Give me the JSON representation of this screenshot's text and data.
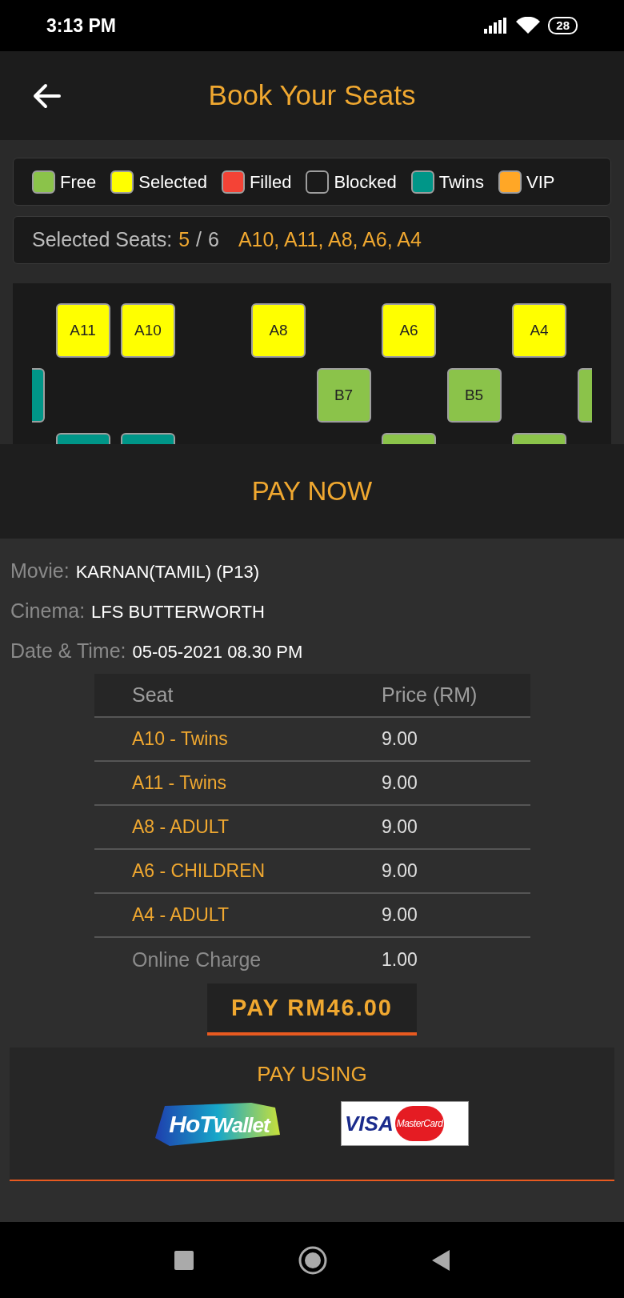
{
  "status_bar": {
    "time": "3:13 PM",
    "battery": "28"
  },
  "header": {
    "title": "Book Your Seats"
  },
  "legend": [
    {
      "label": "Free",
      "color": "#8bc34a"
    },
    {
      "label": "Selected",
      "color": "#ffff00"
    },
    {
      "label": "Filled",
      "color": "#f44336"
    },
    {
      "label": "Blocked",
      "color": "#1a1a1a"
    },
    {
      "label": "Twins",
      "color": "#009688"
    },
    {
      "label": "VIP",
      "color": "#ffa726"
    }
  ],
  "selection": {
    "label": "Selected Seats:",
    "count": "5",
    "separator": "/",
    "max": "6",
    "seats": "A10, A11, A8, A6, A4"
  },
  "seat_rows": [
    {
      "slots": [
        {
          "kind": "space"
        },
        {
          "kind": "seat",
          "label": "A11",
          "color": "#ffff00"
        },
        {
          "kind": "seat",
          "label": "A10",
          "color": "#ffff00"
        },
        {
          "kind": "space"
        },
        {
          "kind": "seat",
          "label": "A8",
          "color": "#ffff00"
        },
        {
          "kind": "space"
        },
        {
          "kind": "seat",
          "label": "A6",
          "color": "#ffff00"
        },
        {
          "kind": "space"
        },
        {
          "kind": "seat",
          "label": "A4",
          "color": "#ffff00"
        }
      ]
    },
    {
      "slots": [
        {
          "kind": "seat",
          "color": "#009688"
        },
        {
          "kind": "space"
        },
        {
          "kind": "space"
        },
        {
          "kind": "space"
        },
        {
          "kind": "space"
        },
        {
          "kind": "seat",
          "label": "B7",
          "color": "#8bc34a"
        },
        {
          "kind": "space"
        },
        {
          "kind": "seat",
          "label": "B5",
          "color": "#8bc34a"
        },
        {
          "kind": "space"
        },
        {
          "kind": "seat",
          "color": "#8bc34a"
        }
      ]
    },
    {
      "slots": [
        {
          "kind": "space"
        },
        {
          "kind": "seat",
          "color": "#009688"
        },
        {
          "kind": "seat",
          "color": "#009688"
        },
        {
          "kind": "space"
        },
        {
          "kind": "space"
        },
        {
          "kind": "space"
        },
        {
          "kind": "seat",
          "color": "#8bc34a"
        },
        {
          "kind": "space"
        },
        {
          "kind": "seat",
          "color": "#8bc34a"
        }
      ]
    }
  ],
  "pay_now": "PAY NOW",
  "details": [
    {
      "label": "Movie:",
      "value": "KARNAN(TAMIL) (P13)"
    },
    {
      "label": "Cinema:",
      "value": "LFS BUTTERWORTH"
    },
    {
      "label": "Date & Time:",
      "value": "05-05-2021 08.30 PM"
    }
  ],
  "table": {
    "columns": [
      "Seat",
      "Price (RM)"
    ],
    "rows": [
      {
        "kind": "seat",
        "seat": "A10 - Twins",
        "price": "9.00"
      },
      {
        "kind": "seat",
        "seat": "A11 - Twins",
        "price": "9.00"
      },
      {
        "kind": "seat",
        "seat": "A8 - ADULT",
        "price": "9.00"
      },
      {
        "kind": "seat",
        "seat": "A6 - CHILDREN",
        "price": "9.00"
      },
      {
        "kind": "seat",
        "seat": "A4 - ADULT",
        "price": "9.00"
      },
      {
        "kind": "charge",
        "seat": "Online Charge",
        "price": "1.00"
      }
    ]
  },
  "pay_button": "PAY RM46.00",
  "pay_using": {
    "title": "PAY USING",
    "methods": [
      {
        "kind": "wallet",
        "texts": [
          "HoT",
          "Wallet"
        ]
      },
      {
        "kind": "cards",
        "texts": [
          "VISA",
          "MasterCard"
        ]
      }
    ]
  }
}
